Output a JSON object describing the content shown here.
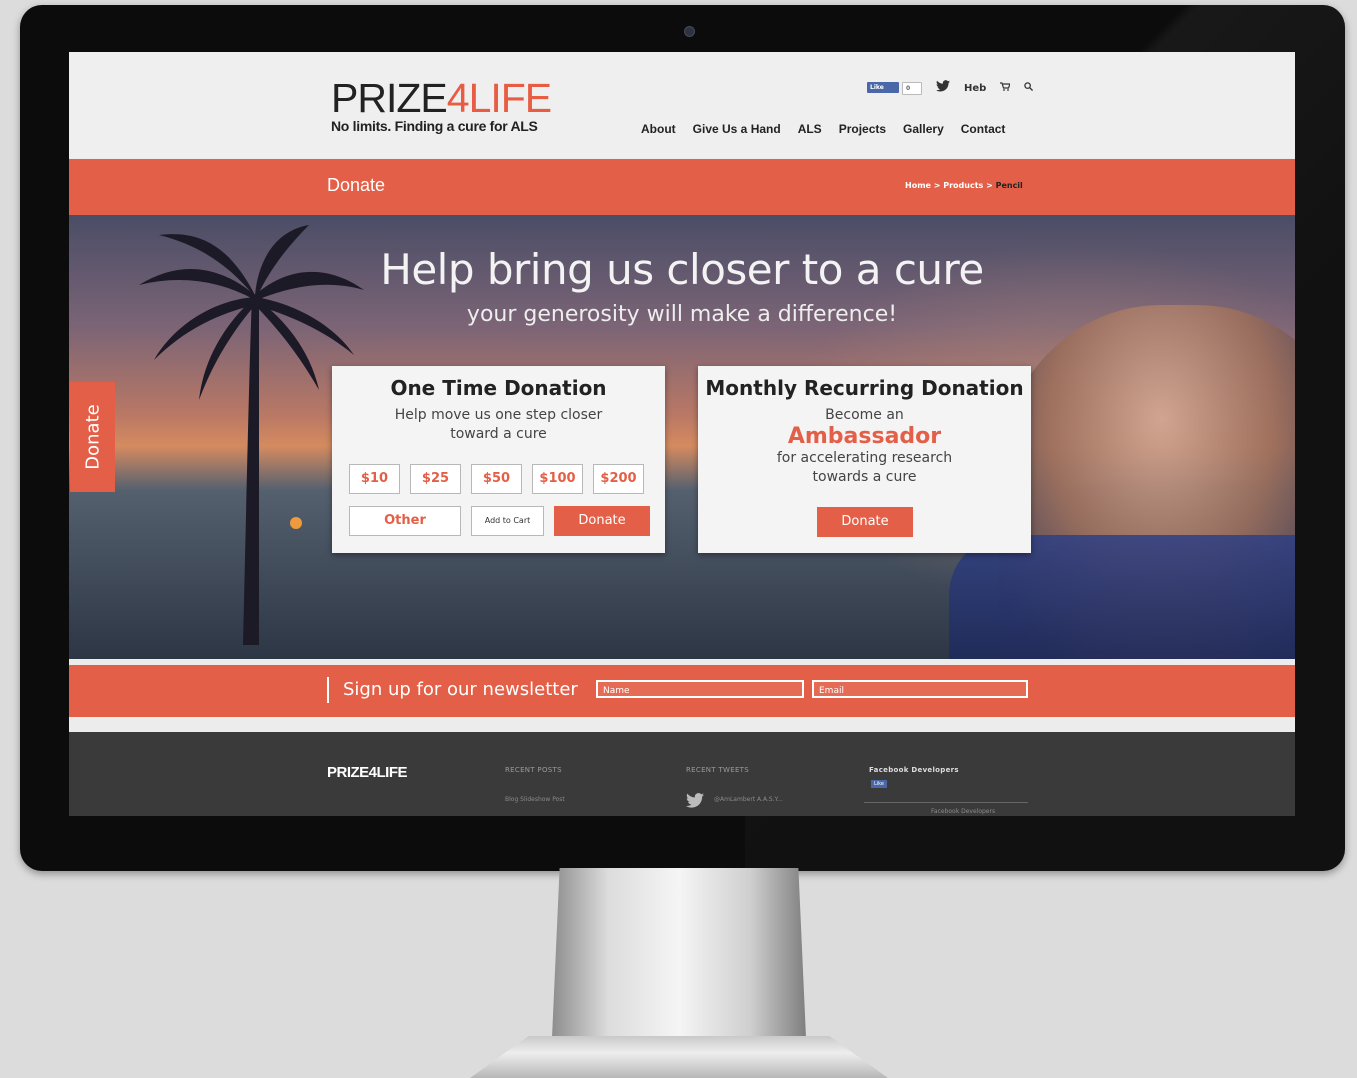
{
  "header": {
    "logo": {
      "part1": "PRIZE",
      "part2": "4",
      "part3": "LIFE"
    },
    "tagline": "No limits. Finding a cure for ALS",
    "utility": {
      "fb_like": "Like",
      "fb_count": "0",
      "language": "Heb"
    },
    "nav": [
      "About",
      "Give Us a Hand",
      "ALS",
      "Projects",
      "Gallery",
      "Contact"
    ]
  },
  "title_bar": {
    "title": "Donate",
    "breadcrumb": {
      "home": "Home",
      "sep1": " > ",
      "products": "Products",
      "sep2": " > ",
      "current": "Pencil"
    }
  },
  "hero": {
    "headline": "Help bring us closer to a cure",
    "subheadline": "your generosity will make a difference!",
    "side_tab": "Donate"
  },
  "one_time": {
    "title": "One Time Donation",
    "subtitle_line1": "Help move us one step closer",
    "subtitle_line2": "toward a cure",
    "amounts": [
      "$10",
      "$25",
      "$50",
      "$100",
      "$200"
    ],
    "other": "Other",
    "add_to_cart": "Add to Cart",
    "donate": "Donate"
  },
  "monthly": {
    "title": "Monthly Recurring Donation",
    "line1": "Become an",
    "highlight": "Ambassador",
    "line2": "for accelerating research",
    "line3": "towards a cure",
    "donate": "Donate"
  },
  "newsletter": {
    "label": "Sign up for our newsletter",
    "name_placeholder": "Name",
    "email_placeholder": "Email"
  },
  "footer": {
    "logo": "PRIZE4LIFE",
    "recent_posts": "RECENT POSTS",
    "post1": "Blog Slideshow Post",
    "recent_tweets": "RECENT TWEETS",
    "tweet": "@AmLambert A.A.S.Y...",
    "facebook_title": "Facebook Developers",
    "fb_like": "Like",
    "facebook_foot": "Facebook Developers"
  },
  "colors": {
    "accent": "#e45f47",
    "footer_bg": "#3a3a3a",
    "header_bg": "#efefef"
  }
}
